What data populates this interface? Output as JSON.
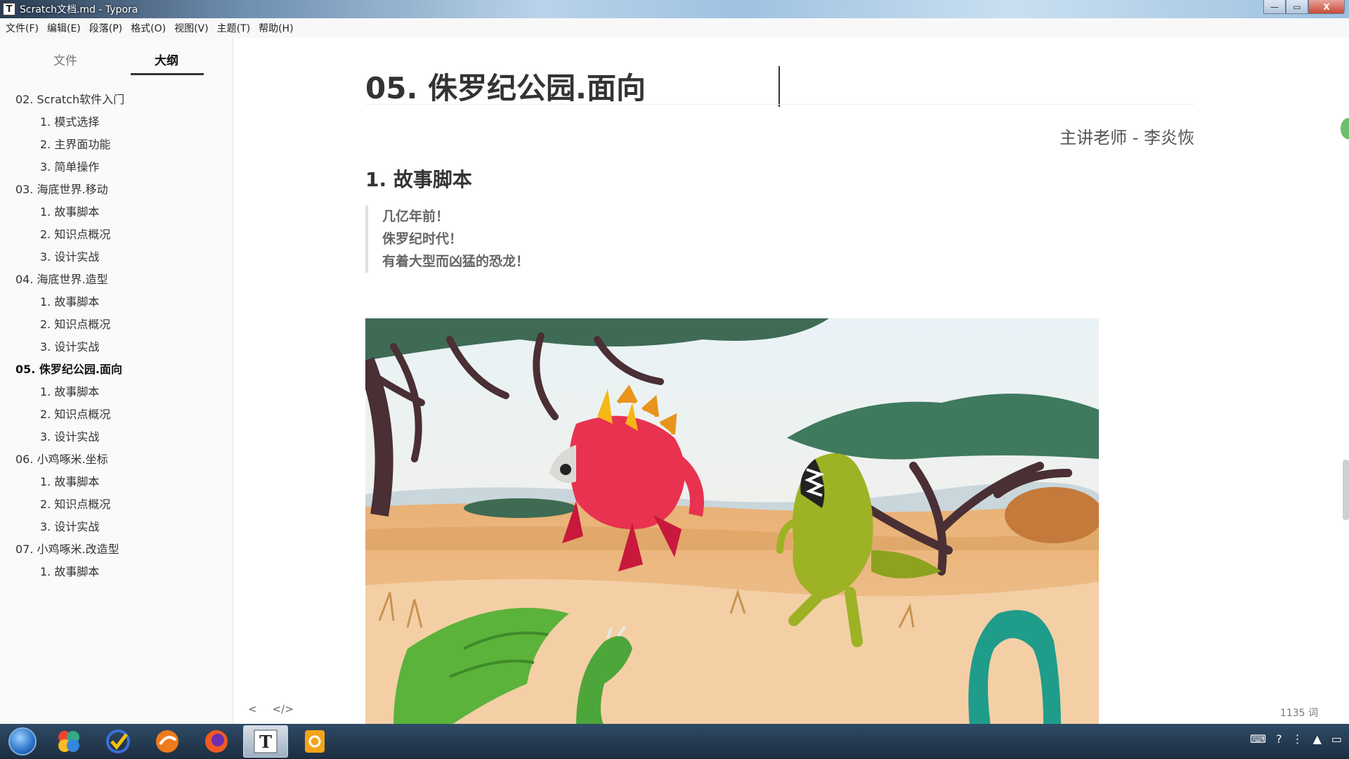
{
  "window": {
    "icon_letter": "T",
    "title": "Scratch文档.md - Typora",
    "minimize": "—",
    "maximize": "▭",
    "close": "X"
  },
  "menu": [
    "文件(F)",
    "编辑(E)",
    "段落(P)",
    "格式(O)",
    "视图(V)",
    "主题(T)",
    "帮助(H)"
  ],
  "sidebar": {
    "tabs": {
      "files": "文件",
      "outline": "大纲"
    },
    "outline": [
      {
        "label": "02. Scratch软件入门",
        "level": 1
      },
      {
        "label": "1. 模式选择",
        "level": 2
      },
      {
        "label": "2. 主界面功能",
        "level": 2
      },
      {
        "label": "3. 简单操作",
        "level": 2
      },
      {
        "label": "03. 海底世界.移动",
        "level": 1
      },
      {
        "label": "1. 故事脚本",
        "level": 2
      },
      {
        "label": "2. 知识点概况",
        "level": 2
      },
      {
        "label": "3. 设计实战",
        "level": 2
      },
      {
        "label": "04. 海底世界.造型",
        "level": 1
      },
      {
        "label": "1. 故事脚本",
        "level": 2
      },
      {
        "label": "2. 知识点概况",
        "level": 2
      },
      {
        "label": "3. 设计实战",
        "level": 2
      },
      {
        "label": "05. 侏罗纪公园.面向",
        "level": 1,
        "active": true
      },
      {
        "label": "1. 故事脚本",
        "level": 2
      },
      {
        "label": "2. 知识点概况",
        "level": 2
      },
      {
        "label": "3. 设计实战",
        "level": 2
      },
      {
        "label": "06. 小鸡啄米.坐标",
        "level": 1
      },
      {
        "label": "1. 故事脚本",
        "level": 2
      },
      {
        "label": "2. 知识点概况",
        "level": 2
      },
      {
        "label": "3. 设计实战",
        "level": 2
      },
      {
        "label": "07. 小鸡啄米.改造型",
        "level": 1
      },
      {
        "label": "1. 故事脚本",
        "level": 2
      }
    ]
  },
  "document": {
    "h1": "05. 侏罗纪公园.面向",
    "author": "主讲老师 - 李炎恢",
    "h2": "1. 故事脚本",
    "quote": [
      "几亿年前！",
      "侏罗纪时代！",
      "有着大型而凶猛的恐龙！"
    ]
  },
  "footer": {
    "back": "<",
    "source_toggle": "</>",
    "word_count": "1135 词"
  },
  "colors": {
    "accent_text": "#333333",
    "sidebar_bg": "#fafafa",
    "taskbar": "#1c2d40"
  }
}
